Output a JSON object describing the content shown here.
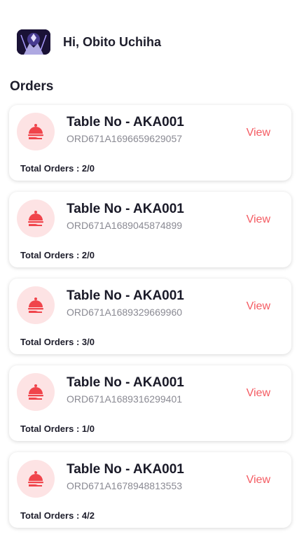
{
  "header": {
    "greeting": "Hi, Obito Uchiha"
  },
  "section_title": "Orders",
  "orders": [
    {
      "table": "Table No - AKA001",
      "order_id": "ORD671A1696659629057",
      "action": "View",
      "total": "Total Orders : 2/0"
    },
    {
      "table": "Table No - AKA001",
      "order_id": "ORD671A1689045874899",
      "action": "View",
      "total": "Total Orders : 2/0"
    },
    {
      "table": "Table No - AKA001",
      "order_id": "ORD671A1689329669960",
      "action": "View",
      "total": "Total Orders : 3/0"
    },
    {
      "table": "Table No - AKA001",
      "order_id": "ORD671A1689316299401",
      "action": "View",
      "total": "Total Orders : 1/0"
    },
    {
      "table": "Table No - AKA001",
      "order_id": "ORD671A1678948813553",
      "action": "View",
      "total": "Total Orders : 4/2"
    }
  ],
  "icons": {
    "order_icon": "food-cloche-icon"
  },
  "colors": {
    "accent": "#f45b62",
    "icon_bg": "#fde3e4"
  }
}
